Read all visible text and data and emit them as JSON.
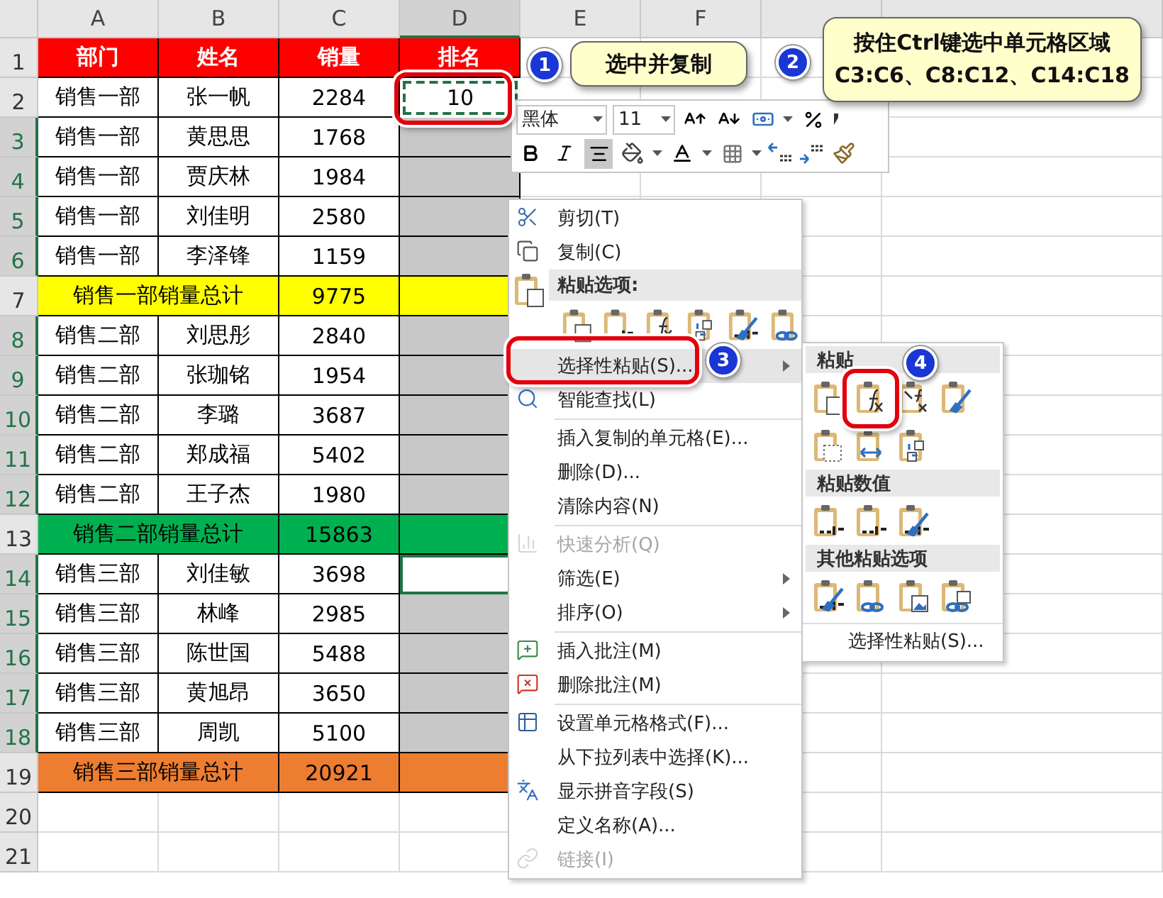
{
  "columns": [
    {
      "label": "A",
      "selected": false
    },
    {
      "label": "B",
      "selected": false
    },
    {
      "label": "C",
      "selected": false
    },
    {
      "label": "D",
      "selected": true
    },
    {
      "label": "E",
      "selected": false
    },
    {
      "label": "F",
      "selected": false
    }
  ],
  "rows": [
    {
      "number": "1",
      "kind": "header",
      "cells": [
        "部门",
        "姓名",
        "销量",
        "排名"
      ],
      "color": "#ff0000",
      "selected": false
    },
    {
      "number": "2",
      "kind": "data",
      "cells": [
        "销售一部",
        "张一帆",
        "2284",
        "10"
      ],
      "selected": false,
      "copied": true,
      "active": false
    },
    {
      "number": "3",
      "kind": "data",
      "cells": [
        "销售一部",
        "黄思思",
        "1768"
      ],
      "selected": true,
      "copied": false,
      "active": false
    },
    {
      "number": "4",
      "kind": "data",
      "cells": [
        "销售一部",
        "贾庆林",
        "1984"
      ],
      "selected": true,
      "copied": false,
      "active": false
    },
    {
      "number": "5",
      "kind": "data",
      "cells": [
        "销售一部",
        "刘佳明",
        "2580"
      ],
      "selected": true,
      "copied": false,
      "active": false
    },
    {
      "number": "6",
      "kind": "data",
      "cells": [
        "销售一部",
        "李泽锋",
        "1159"
      ],
      "selected": true,
      "copied": false,
      "active": false
    },
    {
      "number": "7",
      "kind": "total",
      "cells": [
        "销售一部销量总计",
        "9775"
      ],
      "color": "#ffff00",
      "selected": false
    },
    {
      "number": "8",
      "kind": "data",
      "cells": [
        "销售二部",
        "刘思彤",
        "2840"
      ],
      "selected": true,
      "copied": false,
      "active": false
    },
    {
      "number": "9",
      "kind": "data",
      "cells": [
        "销售二部",
        "张珈铭",
        "1954"
      ],
      "selected": true,
      "copied": false,
      "active": false
    },
    {
      "number": "10",
      "kind": "data",
      "cells": [
        "销售二部",
        "李璐",
        "3687"
      ],
      "selected": true,
      "copied": false,
      "active": false
    },
    {
      "number": "11",
      "kind": "data",
      "cells": [
        "销售二部",
        "郑成福",
        "5402"
      ],
      "selected": true,
      "copied": false,
      "active": false
    },
    {
      "number": "12",
      "kind": "data",
      "cells": [
        "销售二部",
        "王子杰",
        "1980"
      ],
      "selected": true,
      "copied": false,
      "active": false
    },
    {
      "number": "13",
      "kind": "total",
      "cells": [
        "销售二部销量总计",
        "15863"
      ],
      "color": "#00b050",
      "selected": false
    },
    {
      "number": "14",
      "kind": "data",
      "cells": [
        "销售三部",
        "刘佳敏",
        "3698"
      ],
      "selected": true,
      "copied": false,
      "active": true
    },
    {
      "number": "15",
      "kind": "data",
      "cells": [
        "销售三部",
        "林峰",
        "2985"
      ],
      "selected": true,
      "copied": false,
      "active": false
    },
    {
      "number": "16",
      "kind": "data",
      "cells": [
        "销售三部",
        "陈世国",
        "5488"
      ],
      "selected": true,
      "copied": false,
      "active": false
    },
    {
      "number": "17",
      "kind": "data",
      "cells": [
        "销售三部",
        "黄旭昂",
        "3650"
      ],
      "selected": true,
      "copied": false,
      "active": false
    },
    {
      "number": "18",
      "kind": "data",
      "cells": [
        "销售三部",
        "周凯",
        "5100"
      ],
      "selected": true,
      "copied": false,
      "active": false
    },
    {
      "number": "19",
      "kind": "total",
      "cells": [
        "销售三部销量总计",
        "20921"
      ],
      "color": "#ed7d31",
      "selected": false
    },
    {
      "number": "20",
      "kind": "empty",
      "selected": false
    },
    {
      "number": "21",
      "kind": "empty",
      "selected": false
    }
  ],
  "mini_toolbar": {
    "font": "黑体",
    "size": "11"
  },
  "context_menu": {
    "items": [
      {
        "label": "剪切(T)",
        "kind": "item",
        "disabled": false,
        "selected": false
      },
      {
        "label": "复制(C)",
        "kind": "item",
        "disabled": false,
        "selected": false
      },
      {
        "label": "粘贴选项:",
        "kind": "header"
      },
      {
        "label": "选择性粘贴(S)...",
        "kind": "submenu",
        "disabled": false,
        "selected": true
      },
      {
        "label": "智能查找(L)",
        "kind": "item",
        "disabled": false,
        "selected": false
      },
      {
        "kind": "separator"
      },
      {
        "label": "插入复制的单元格(E)...",
        "kind": "item",
        "disabled": false,
        "selected": false
      },
      {
        "label": "删除(D)...",
        "kind": "item",
        "disabled": false,
        "selected": false
      },
      {
        "label": "清除内容(N)",
        "kind": "item",
        "disabled": false,
        "selected": false
      },
      {
        "kind": "separator"
      },
      {
        "label": "快速分析(Q)",
        "kind": "item",
        "disabled": true,
        "selected": false
      },
      {
        "label": "筛选(E)",
        "kind": "submenu",
        "disabled": false,
        "selected": false
      },
      {
        "label": "排序(O)",
        "kind": "submenu",
        "disabled": false,
        "selected": false
      },
      {
        "kind": "separator"
      },
      {
        "label": "插入批注(M)",
        "kind": "item",
        "disabled": false,
        "selected": false
      },
      {
        "label": "删除批注(M)",
        "kind": "item",
        "disabled": false,
        "selected": false
      },
      {
        "kind": "separator"
      },
      {
        "label": "设置单元格格式(F)...",
        "kind": "item",
        "disabled": false,
        "selected": false
      },
      {
        "label": "从下拉列表中选择(K)...",
        "kind": "item",
        "disabled": false,
        "selected": false
      },
      {
        "label": "显示拼音字段(S)",
        "kind": "item",
        "disabled": false,
        "selected": false
      },
      {
        "label": "定义名称(A)...",
        "kind": "item",
        "disabled": false,
        "selected": false
      },
      {
        "label": "链接(I)",
        "kind": "item",
        "disabled": true,
        "selected": false
      }
    ]
  },
  "submenu": {
    "sections": [
      {
        "title": "粘贴"
      },
      {
        "title": "粘贴数值"
      },
      {
        "title": "其他粘贴选项"
      }
    ],
    "footer": "选择性粘贴(S)..."
  },
  "callouts": [
    {
      "number": "1",
      "lines": [
        "选中并复制"
      ]
    },
    {
      "number": "2",
      "lines": [
        "按住Ctrl键选中单元格区域",
        "C3:C6、C8:C12、C14:C18"
      ]
    }
  ],
  "markers": [
    {
      "number": "3"
    },
    {
      "number": "4"
    }
  ]
}
